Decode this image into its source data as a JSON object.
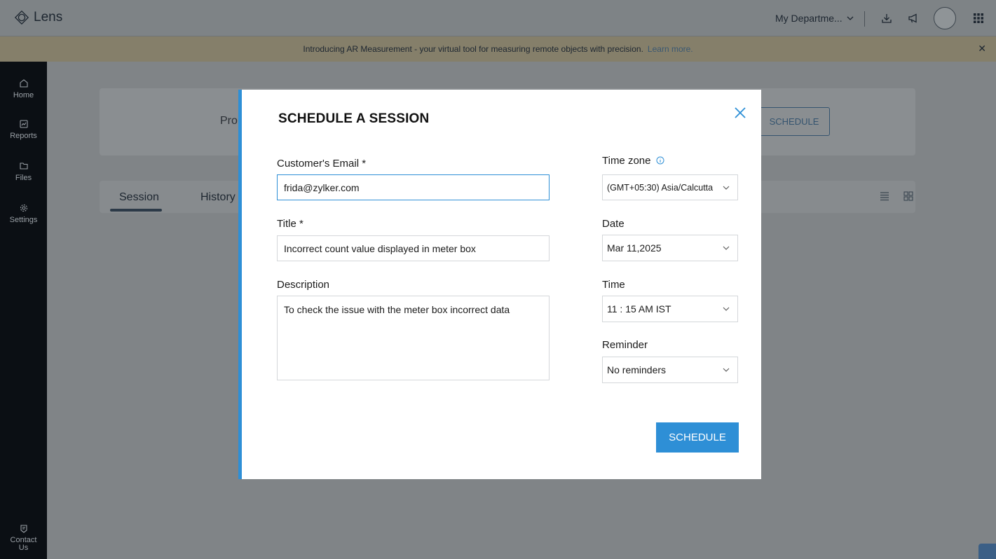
{
  "app": {
    "name": "Lens"
  },
  "topbar": {
    "department": "My Departme...",
    "icons": [
      "download-icon",
      "megaphone-icon",
      "avatar",
      "apps-grid-icon"
    ]
  },
  "banner": {
    "text": "Introducing AR Measurement - your virtual tool for measuring remote objects with precision.",
    "link": "Learn more.",
    "close": "✕"
  },
  "sidebar": {
    "items": [
      {
        "label": "Home",
        "icon": "home-icon"
      },
      {
        "label": "Reports",
        "icon": "reports-icon"
      },
      {
        "label": "Files",
        "icon": "folder-icon"
      },
      {
        "label": "Settings",
        "icon": "gear-icon"
      }
    ],
    "contact": {
      "line1": "Contact",
      "line2": "Us",
      "icon": "contact-icon"
    }
  },
  "background": {
    "pro_text": "Pro",
    "schedule_button": "SCHEDULE",
    "tabs": [
      {
        "label": "Session"
      },
      {
        "label": "History"
      }
    ]
  },
  "modal": {
    "title": "SCHEDULE A SESSION",
    "email": {
      "label": "Customer's Email *",
      "value": "frida@zylker.com"
    },
    "title_field": {
      "label": "Title *",
      "value": "Incorrect count value displayed in meter box"
    },
    "description": {
      "label": "Description",
      "value": "To check the issue with the meter box incorrect data"
    },
    "timezone": {
      "label": "Time zone",
      "value": "(GMT+05:30) Asia/Calcutta"
    },
    "date": {
      "label": "Date",
      "value": "Mar 11,2025"
    },
    "time": {
      "label": "Time",
      "value": "11 : 15 AM IST"
    },
    "reminder": {
      "label": "Reminder",
      "value": "No reminders"
    },
    "submit": "SCHEDULE"
  },
  "colors": {
    "accent": "#2e8fd6",
    "sidebar": "#0b0f14"
  }
}
